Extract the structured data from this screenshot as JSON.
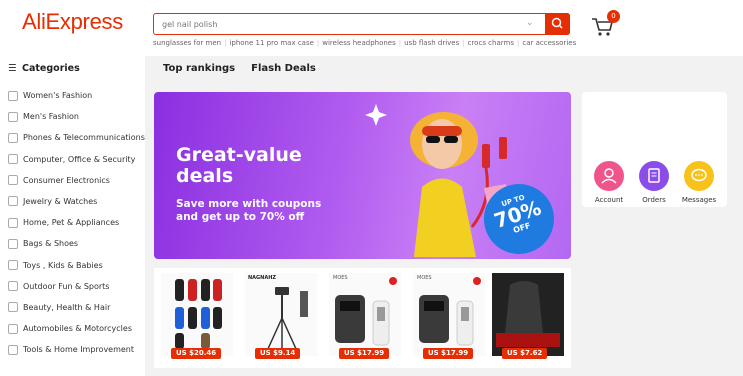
{
  "header": {
    "logo": "AliExpress",
    "search_placeholder": "gel nail polish",
    "cart_count": "0",
    "hot_searches": [
      "sunglasses for men",
      "iphone 11 pro max case",
      "wireless headphones",
      "usb flash drives",
      "crocs charms",
      "car accessories"
    ]
  },
  "sidebar": {
    "title": "Categories",
    "items": [
      {
        "label": "Women's Fashion",
        "icon": "dress-icon"
      },
      {
        "label": "Men's Fashion",
        "icon": "shirt-icon"
      },
      {
        "label": "Phones & Telecommunications",
        "icon": "phone-icon"
      },
      {
        "label": "Computer, Office & Security",
        "icon": "laptop-icon"
      },
      {
        "label": "Consumer Electronics",
        "icon": "camera-icon"
      },
      {
        "label": "Jewelry & Watches",
        "icon": "ring-icon"
      },
      {
        "label": "Home, Pet & Appliances",
        "icon": "sofa-icon"
      },
      {
        "label": "Bags & Shoes",
        "icon": "bag-icon"
      },
      {
        "label": "Toys , Kids & Babies",
        "icon": "baby-bottle-icon"
      },
      {
        "label": "Outdoor Fun & Sports",
        "icon": "ball-icon"
      },
      {
        "label": "Beauty, Health & Hair",
        "icon": "lipstick-icon"
      },
      {
        "label": "Automobiles & Motorcycles",
        "icon": "steering-wheel-icon"
      },
      {
        "label": "Tools & Home Improvement",
        "icon": "hammer-icon"
      }
    ]
  },
  "tabs": [
    "Top rankings",
    "Flash Deals"
  ],
  "banner": {
    "headline": "Great-value deals",
    "subline": "Save more with coupons and get up to 70% off",
    "badge_top": "UP TO",
    "badge_pct": "70%",
    "badge_off": "OFF"
  },
  "account": {
    "items": [
      {
        "label": "Account",
        "icon": "user-icon",
        "color": "#f0548c"
      },
      {
        "label": "Orders",
        "icon": "orders-icon",
        "color": "#8a4de8"
      },
      {
        "label": "Messages",
        "icon": "messages-icon",
        "color": "#f7c21a"
      }
    ]
  },
  "products": [
    {
      "price": "US $20.46",
      "brand": ""
    },
    {
      "price": "US $9.14",
      "brand": "NAGNAHZ"
    },
    {
      "price": "US $17.99",
      "brand": "MOES"
    },
    {
      "price": "US $17.99",
      "brand": "MOES"
    },
    {
      "price": "US $7.62",
      "brand": ""
    }
  ],
  "colors": {
    "brand": "#e62e04",
    "banner": "#a14ce8"
  }
}
